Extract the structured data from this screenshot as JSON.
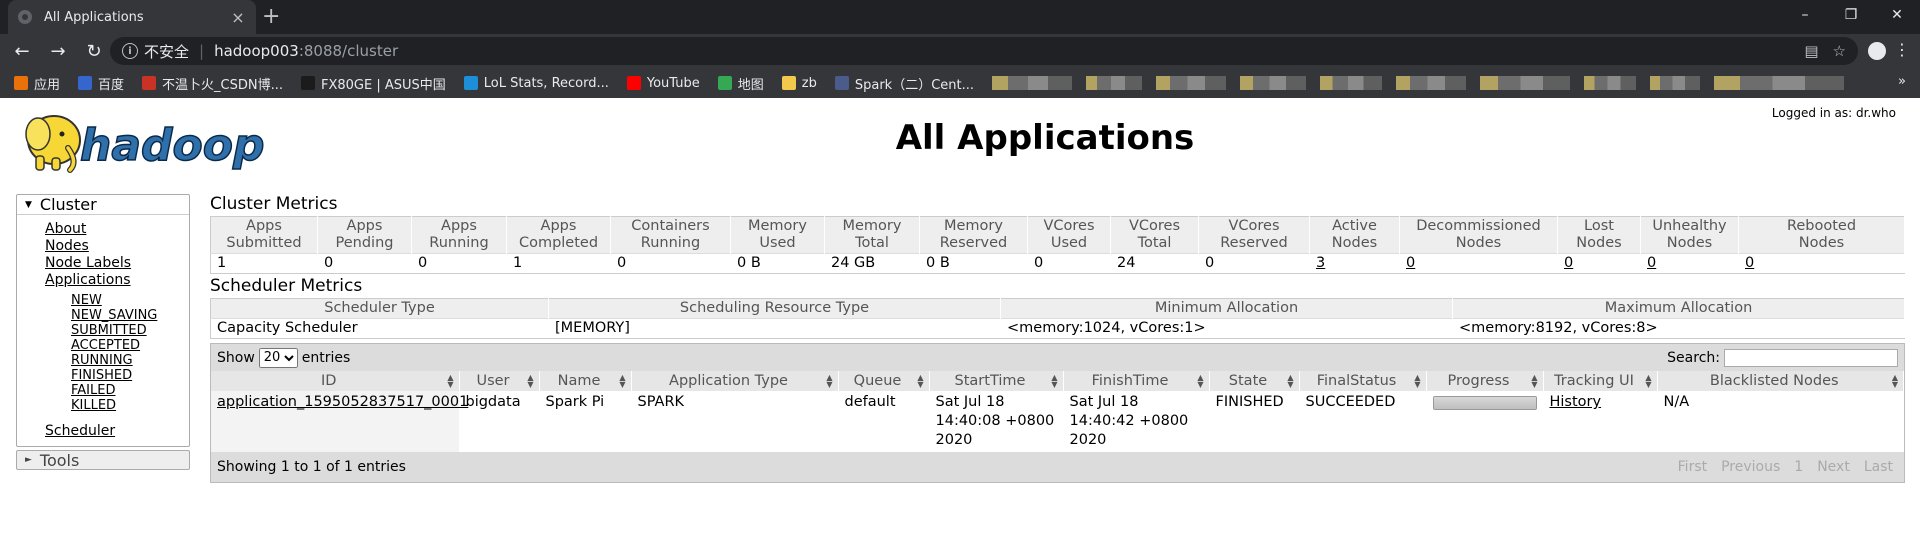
{
  "browser": {
    "tab_title": "All Applications",
    "new_tab": "+",
    "close": "×",
    "insecure_label": "不安全",
    "url_host": "hadoop003",
    "url_rest": ":8088/cluster",
    "controls": {
      "minimize": "–",
      "restore": "❐",
      "close": "✕"
    },
    "bookmarks": [
      {
        "label": "应用",
        "color": "#e8710a"
      },
      {
        "label": "百度",
        "color": "#3466ce"
      },
      {
        "label": "不温卜火_CSDN博...",
        "color": "#c93325"
      },
      {
        "label": "FX80GE | ASUS中国",
        "color": "#1b1b1b"
      },
      {
        "label": "LoL Stats, Record...",
        "color": "#1c8fd8"
      },
      {
        "label": "YouTube",
        "color": "#ff0000"
      },
      {
        "label": "地图",
        "color": "#34a853"
      },
      {
        "label": "zb",
        "color": "#f2c94c"
      },
      {
        "label": "Spark（二）Cent...",
        "color": "#4a5b8c"
      }
    ],
    "more": "»"
  },
  "header": {
    "logged_in": "Logged in as: dr.who",
    "page_title": "All Applications",
    "logo_text": "hadoop"
  },
  "sidebar": {
    "cluster_label": "Cluster",
    "items": [
      "About",
      "Nodes",
      "Node Labels",
      "Applications"
    ],
    "app_states": [
      "NEW",
      "NEW_SAVING",
      "SUBMITTED",
      "ACCEPTED",
      "RUNNING",
      "FINISHED",
      "FAILED",
      "KILLED"
    ],
    "scheduler": "Scheduler",
    "tools_label": "Tools"
  },
  "cluster_metrics": {
    "title": "Cluster Metrics",
    "headers": [
      [
        "Apps",
        "Submitted"
      ],
      [
        "Apps",
        "Pending"
      ],
      [
        "Apps",
        "Running"
      ],
      [
        "Apps",
        "Completed"
      ],
      [
        "Containers",
        "Running"
      ],
      [
        "Memory",
        "Used"
      ],
      [
        "Memory",
        "Total"
      ],
      [
        "Memory",
        "Reserved"
      ],
      [
        "VCores",
        "Used"
      ],
      [
        "VCores",
        "Total"
      ],
      [
        "VCores",
        "Reserved"
      ],
      [
        "Active",
        "Nodes"
      ],
      [
        "Decommissioned",
        "Nodes"
      ],
      [
        "Lost",
        "Nodes"
      ],
      [
        "Unhealthy",
        "Nodes"
      ],
      [
        "Rebooted",
        "Nodes"
      ]
    ],
    "values": [
      "1",
      "0",
      "0",
      "1",
      "0",
      "0 B",
      "24 GB",
      "0 B",
      "0",
      "24",
      "0",
      "3",
      "0",
      "0",
      "0",
      "0"
    ]
  },
  "scheduler_metrics": {
    "title": "Scheduler Metrics",
    "headers": [
      "Scheduler Type",
      "Scheduling Resource Type",
      "Minimum Allocation",
      "Maximum Allocation"
    ],
    "values": [
      "Capacity Scheduler",
      "[MEMORY]",
      "<memory:1024, vCores:1>",
      "<memory:8192, vCores:8>"
    ]
  },
  "apps_table": {
    "show_label": "Show",
    "entries_label": "entries",
    "page_size": "20",
    "search_label": "Search:",
    "headers": [
      "ID",
      "User",
      "Name",
      "Application Type",
      "Queue",
      "StartTime",
      "FinishTime",
      "State",
      "FinalStatus",
      "Progress",
      "Tracking UI",
      "Blacklisted Nodes"
    ],
    "rows": [
      {
        "id": "application_1595052837517_0001",
        "user": "bigdata",
        "name": "Spark Pi",
        "type": "SPARK",
        "queue": "default",
        "start": "Sat Jul 18 14:40:08 +0800 2020",
        "finish": "Sat Jul 18 14:40:42 +0800 2020",
        "state": "FINISHED",
        "final_status": "SUCCEEDED",
        "progress": 100,
        "tracking": "History",
        "blacklisted": "N/A"
      }
    ],
    "info": "Showing 1 to 1 of 1 entries",
    "pager": [
      "First",
      "Previous",
      "1",
      "Next",
      "Last"
    ]
  }
}
